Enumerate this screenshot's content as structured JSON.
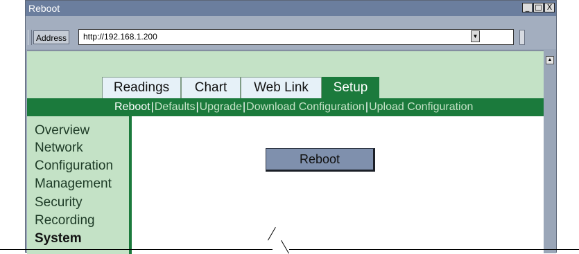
{
  "window": {
    "title": "Reboot"
  },
  "window_buttons": {
    "minimize": "_",
    "maximize": "□",
    "close": "X"
  },
  "address_bar": {
    "label": "Address",
    "url": "http://192.168.1.200"
  },
  "tabs": [
    {
      "label": "Readings",
      "active": false
    },
    {
      "label": "Chart",
      "active": false
    },
    {
      "label": "Web Link",
      "active": false
    },
    {
      "label": "Setup",
      "active": true
    }
  ],
  "subnav": {
    "items": [
      "Reboot",
      "Defaults",
      "Upgrade",
      "Download Configuration",
      "Upload Configuration"
    ],
    "current": "Reboot",
    "separator": "|"
  },
  "sidebar": {
    "items": [
      {
        "label": "Overview",
        "bold": false
      },
      {
        "label": "Network",
        "bold": false
      },
      {
        "label": "Configuration",
        "bold": false
      },
      {
        "label": "Management",
        "bold": false
      },
      {
        "label": "Security",
        "bold": false
      },
      {
        "label": "Recording",
        "bold": false
      },
      {
        "label": "System",
        "bold": true
      }
    ]
  },
  "main": {
    "reboot_button": "Reboot"
  },
  "colors": {
    "accent_green": "#1b7a3c",
    "light_green": "#c4e2c6",
    "tab_light": "#e6f1f8",
    "window_gray": "#9aa6b8",
    "titlebar": "#6b7e9e",
    "button": "#7f90ad"
  }
}
